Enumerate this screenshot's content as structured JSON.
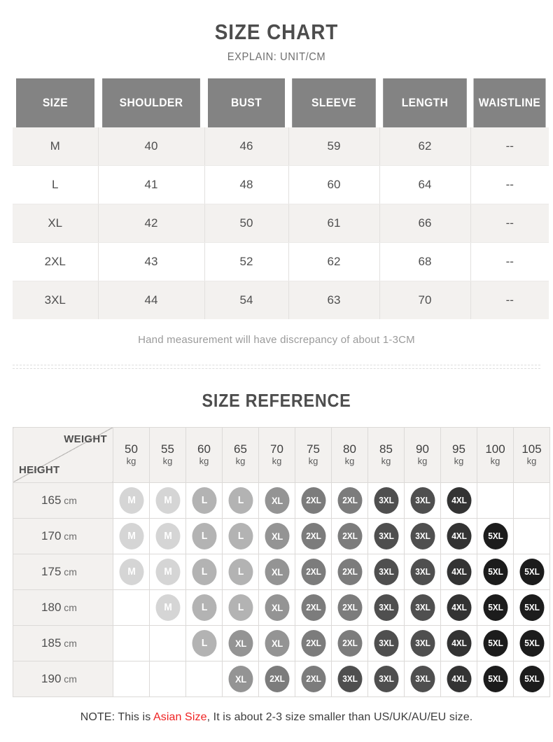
{
  "section_one": {
    "title": "SIZE CHART",
    "subtitle": "EXPLAIN: UNIT/CM",
    "columns": [
      "SIZE",
      "SHOULDER",
      "BUST",
      "SLEEVE",
      "LENGTH",
      "WAISTLINE"
    ],
    "rows": [
      [
        "M",
        "40",
        "46",
        "59",
        "62",
        "--"
      ],
      [
        "L",
        "41",
        "48",
        "60",
        "64",
        "--"
      ],
      [
        "XL",
        "42",
        "50",
        "61",
        "66",
        "--"
      ],
      [
        "2XL",
        "43",
        "52",
        "62",
        "68",
        "--"
      ],
      [
        "3XL",
        "44",
        "54",
        "63",
        "70",
        "--"
      ]
    ],
    "note": "Hand measurement will have discrepancy of about 1-3CM"
  },
  "section_two": {
    "title": "SIZE REFERENCE",
    "corner": {
      "weight_label": "WEIGHT",
      "height_label": "HEIGHT"
    },
    "weight_unit": "kg",
    "height_unit": "cm",
    "weights": [
      "50",
      "55",
      "60",
      "65",
      "70",
      "75",
      "80",
      "85",
      "90",
      "95",
      "100",
      "105"
    ],
    "heights": [
      "165",
      "170",
      "175",
      "180",
      "185",
      "190"
    ],
    "grid": [
      [
        "M",
        "M",
        "L",
        "L",
        "XL",
        "2XL",
        "2XL",
        "3XL",
        "3XL",
        "4XL",
        "",
        ""
      ],
      [
        "M",
        "M",
        "L",
        "L",
        "XL",
        "2XL",
        "2XL",
        "3XL",
        "3XL",
        "4XL",
        "5XL",
        ""
      ],
      [
        "M",
        "M",
        "L",
        "L",
        "XL",
        "2XL",
        "2XL",
        "3XL",
        "3XL",
        "4XL",
        "5XL",
        "5XL"
      ],
      [
        "",
        "M",
        "L",
        "L",
        "XL",
        "2XL",
        "2XL",
        "3XL",
        "3XL",
        "4XL",
        "5XL",
        "5XL"
      ],
      [
        "",
        "",
        "L",
        "XL",
        "XL",
        "2XL",
        "2XL",
        "3XL",
        "3XL",
        "4XL",
        "5XL",
        "5XL"
      ],
      [
        "",
        "",
        "",
        "XL",
        "2XL",
        "2XL",
        "3XL",
        "3XL",
        "3XL",
        "4XL",
        "5XL",
        "5XL"
      ]
    ]
  },
  "footer": {
    "prefix": "NOTE: This is ",
    "accent": "Asian Size",
    "suffix": ", It is about 2-3 size smaller than US/UK/AU/EU size."
  },
  "colors": {
    "header_gray": "#838383",
    "row_alt": "#f3f1ef",
    "accent_red": "#ef2222",
    "badge_M": "#d5d5d5",
    "badge_L": "#b3b3b3",
    "badge_XL": "#949494",
    "badge_2XL": "#7c7c7c",
    "badge_3XL": "#4f4f4f",
    "badge_4XL": "#333333",
    "badge_5XL": "#1c1c1c"
  }
}
